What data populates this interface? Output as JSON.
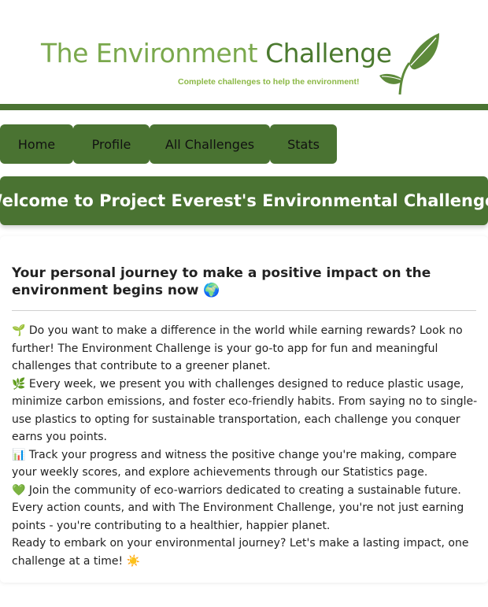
{
  "header": {
    "title_part1": "The Environment ",
    "title_part2": "Challenge",
    "tagline": "Complete challenges to help the environment!",
    "logo_icon": "leaf-icon"
  },
  "nav": {
    "items": [
      {
        "label": "Home"
      },
      {
        "label": "Profile"
      },
      {
        "label": "All Challenges"
      },
      {
        "label": "Stats"
      }
    ]
  },
  "welcome": {
    "title": "Welcome to Project Everest's Environmental Challenge!"
  },
  "content": {
    "subtitle": "Your personal journey to make a positive impact on the environment begins now 🌍",
    "paragraphs": [
      "🌱 Do you want to make a difference in the world while earning rewards? Look no further! The Environment Challenge is your go-to app for fun and meaningful challenges that contribute to a greener planet.",
      "🌿 Every week, we present you with challenges designed to reduce plastic usage, minimize carbon emissions, and foster eco-friendly habits. From saying no to single-use plastics to opting for sustainable transportation, each challenge you conquer earns you points.",
      "📊 Track your progress and witness the positive change you're making, compare your weekly scores, and explore achievements through our Statistics page.",
      "💚 Join the community of eco-warriors dedicated to creating a sustainable future. Every action counts, and with The Environment Challenge, you're not just earning points - you're contributing to a healthier, happier planet.",
      "Ready to embark on your environmental journey? Let's make a lasting impact, one challenge at a time! ☀️"
    ]
  },
  "colors": {
    "brand_green": "#4a7332",
    "title_light_green": "#7aa84c",
    "tagline_green": "#8bb845"
  }
}
